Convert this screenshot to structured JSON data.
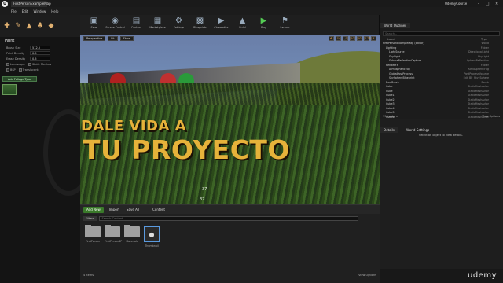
{
  "app": {
    "doc_tab": "FirstPersonExampleMap",
    "project_name": "UdemyCourse",
    "window_controls": [
      "–",
      "□",
      "✕"
    ]
  },
  "menu": [
    "File",
    "Edit",
    "Window",
    "Help"
  ],
  "left_panel": {
    "mode_icons": [
      "place-icon",
      "paint-icon",
      "landscape-icon",
      "foliage-icon",
      "geometry-icon"
    ],
    "paint_title": "Paint",
    "props": [
      {
        "label": "Brush Size",
        "value": "512.0"
      },
      {
        "label": "Paint Density",
        "value": "0.5"
      },
      {
        "label": "Erase Density",
        "value": "0.5"
      }
    ],
    "checks": [
      [
        "Landscape",
        "Static Meshes"
      ],
      [
        "BSP",
        "Translucent"
      ]
    ],
    "brush_type": "+ Add Foliage Type",
    "thumb_name": "grass"
  },
  "toolbar": [
    "Save",
    "Source Control",
    "Content",
    "Marketplace",
    "Settings",
    "Blueprints",
    "Cinematics",
    "Build",
    "Play",
    "Launch"
  ],
  "viewport": {
    "chips": [
      "Perspective",
      "Lit",
      "Show"
    ],
    "right_icons": [
      "10",
      "10°",
      "0.25",
      "4"
    ],
    "num_a": "37",
    "num_b": "37"
  },
  "overlay": {
    "line1": "DALE VIDA A",
    "line2": "TU PROYECTO"
  },
  "content_browser": {
    "add_new": "Add New",
    "import": "Import",
    "save_all": "Save All",
    "path": "Content",
    "filters": "Filters",
    "search_placeholder": "Search Content",
    "items": [
      {
        "name": "FirstPerson",
        "kind": "folder"
      },
      {
        "name": "FirstPersonBP",
        "kind": "folder"
      },
      {
        "name": "Materials",
        "kind": "folder"
      },
      {
        "name": "Thumbnail",
        "kind": "asset"
      }
    ],
    "status": "4 items",
    "view_options": "View Options"
  },
  "world_outliner": {
    "tab": "World Outliner",
    "search_placeholder": "Search...",
    "col_label": "Label",
    "col_type": "Type",
    "rows": [
      {
        "label": "FirstPersonExampleMap (Editor)",
        "type": "World"
      },
      {
        "label": "Lighting",
        "type": "Folder"
      },
      {
        "label": "LightSource",
        "type": "DirectionalLight"
      },
      {
        "label": "SkyLight",
        "type": "SkyLight"
      },
      {
        "label": "SphereReflectionCapture",
        "type": "SphereReflection"
      },
      {
        "label": "RenderFX",
        "type": "Folder"
      },
      {
        "label": "AtmosphericFog",
        "type": "AtmosphericFog"
      },
      {
        "label": "GlobalPostProcess",
        "type": "PostProcessVolume"
      },
      {
        "label": "SkySphereBlueprint",
        "type": "Edit BP_Sky_Sphere"
      },
      {
        "label": "Box Brush",
        "type": "Brush"
      },
      {
        "label": "Cube",
        "type": "StaticMeshActor"
      },
      {
        "label": "Cube",
        "type": "StaticMeshActor"
      },
      {
        "label": "Cube1",
        "type": "StaticMeshActor"
      },
      {
        "label": "Cube2",
        "type": "StaticMeshActor"
      },
      {
        "label": "Cube3",
        "type": "StaticMeshActor"
      },
      {
        "label": "Cube4",
        "type": "StaticMeshActor"
      },
      {
        "label": "Cube5",
        "type": "StaticMeshActor"
      },
      {
        "label": "Cube6",
        "type": "StaticMeshActor"
      },
      {
        "label": "Cube7",
        "type": "StaticMeshActor"
      }
    ],
    "count": "190 actors",
    "view_options": "View Options"
  },
  "details": {
    "tab": "Details",
    "tab2": "World Settings",
    "message": "Select an object to view details."
  },
  "watermark": "udemy"
}
